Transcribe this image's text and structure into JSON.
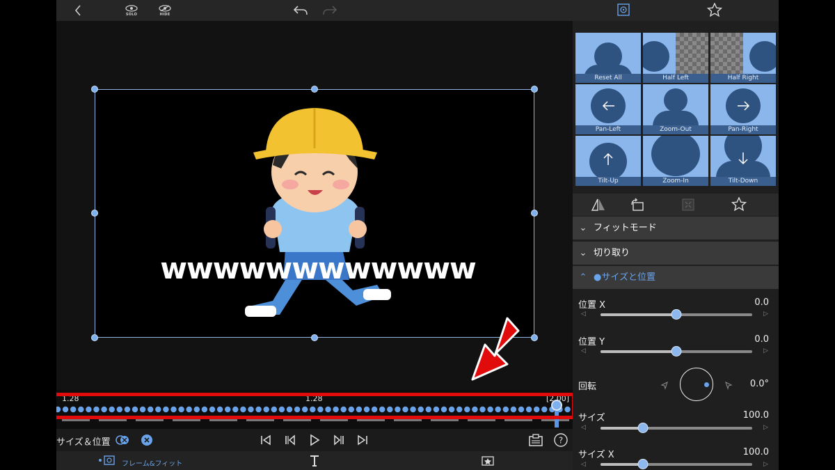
{
  "top_bar": {
    "solo_label": "SOLO",
    "hide_label": "HIDE"
  },
  "preview": {
    "overlay_text": "wwwwwwwwwwww"
  },
  "timeline": {
    "start_time": "1.28",
    "mid_time": "1.28",
    "end_time": "[2.00]"
  },
  "bottom_toolbar": {
    "mode_label": "サイズ＆位置"
  },
  "bottom_tabs": {
    "frame_fit_label": "フレーム&フィット"
  },
  "presets": [
    {
      "label": "Reset All"
    },
    {
      "label": "Half Left"
    },
    {
      "label": "Half Right"
    },
    {
      "label": "Pan-Left"
    },
    {
      "label": "Zoom-Out"
    },
    {
      "label": "Pan-Right"
    },
    {
      "label": "Tilt-Up"
    },
    {
      "label": "Zoom-In"
    },
    {
      "label": "Tilt-Down"
    }
  ],
  "sections": {
    "fit_mode": "フィットモード",
    "crop": "切り取り",
    "size_position": "●サイズと位置"
  },
  "params": {
    "pos_x": {
      "label": "位置 X",
      "value": "0.0",
      "fraction": 0.5
    },
    "pos_y": {
      "label": "位置 Y",
      "value": "0.0",
      "fraction": 0.5
    },
    "rotation": {
      "label": "回転",
      "value": "0.0°"
    },
    "size": {
      "label": "サイズ",
      "value": "100.0",
      "fraction": 0.28
    },
    "size_x": {
      "label": "サイズ X",
      "value": "100.0",
      "fraction": 0.28
    }
  },
  "colors": {
    "accent": "#6aa3ea",
    "highlight_red": "#e20b0b"
  }
}
